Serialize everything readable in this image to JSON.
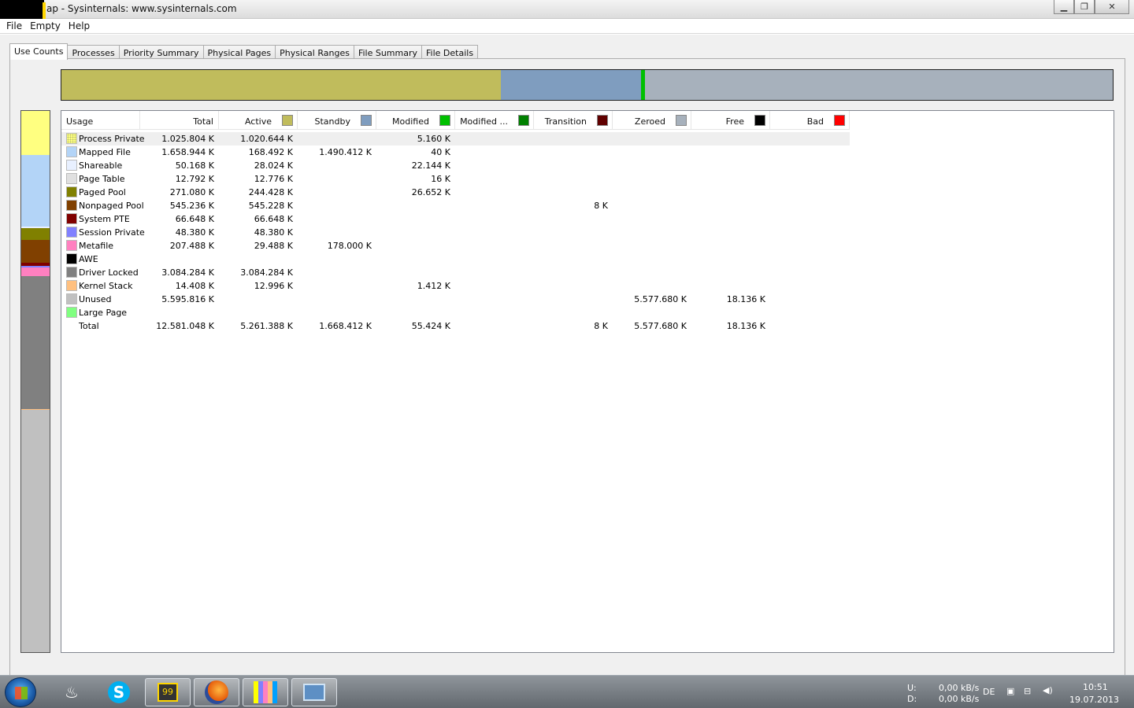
{
  "window": {
    "title": "ap - Sysinternals: www.sysinternals.com",
    "buttons": [
      "minimize",
      "maximize",
      "close"
    ]
  },
  "menu": [
    "File",
    "Empty",
    "Help"
  ],
  "tabs": [
    "Use Counts",
    "Processes",
    "Priority Summary",
    "Physical Pages",
    "Physical Ranges",
    "File Summary",
    "File Details"
  ],
  "active_tab": "Use Counts",
  "topbar_segments": [
    {
      "name": "Active",
      "fraction": 0.418,
      "color": "#c0bc5c"
    },
    {
      "name": "Standby",
      "fraction": 0.133,
      "color": "#7f9dbf"
    },
    {
      "name": "Modified",
      "fraction": 0.004,
      "color": "#00c000"
    },
    {
      "name": "Zeroed",
      "fraction": 0.445,
      "color": "#a7b1bc"
    }
  ],
  "sidebar_segments": [
    {
      "name": "Process Private",
      "fraction": 0.081,
      "color": "#ffff80"
    },
    {
      "name": "Mapped File",
      "fraction": 0.132,
      "color": "#b3d4f7"
    },
    {
      "name": "Shareable",
      "fraction": 0.004,
      "color": "#e8f0ff"
    },
    {
      "name": "Paged Pool",
      "fraction": 0.021,
      "color": "#808000"
    },
    {
      "name": "Nonpaged Pool",
      "fraction": 0.043,
      "color": "#804000"
    },
    {
      "name": "System PTE",
      "fraction": 0.005,
      "color": "#800000"
    },
    {
      "name": "Session Private",
      "fraction": 0.004,
      "color": "#8080ff"
    },
    {
      "name": "Metafile",
      "fraction": 0.016,
      "color": "#ff80c0"
    },
    {
      "name": "Driver Locked",
      "fraction": 0.245,
      "color": "#808080"
    },
    {
      "name": "Kernel Stack",
      "fraction": 0.001,
      "color": "#ffc080"
    },
    {
      "name": "Unused",
      "fraction": 0.448,
      "color": "#c0c0c0"
    }
  ],
  "columns": [
    {
      "label": "Usage",
      "swatch": null
    },
    {
      "label": "Total",
      "swatch": null
    },
    {
      "label": "Active",
      "swatch": "#c0bc5c"
    },
    {
      "label": "Standby",
      "swatch": "#7f9dbf"
    },
    {
      "label": "Modified",
      "swatch": "#00c000"
    },
    {
      "label": "Modified ...",
      "swatch": "#008000"
    },
    {
      "label": "Transition",
      "swatch": "#600000"
    },
    {
      "label": "Zeroed",
      "swatch": "#a7b1bc"
    },
    {
      "label": "Free",
      "swatch": "#000000"
    },
    {
      "label": "Bad",
      "swatch": "#ff0000"
    }
  ],
  "rows": [
    {
      "name": "Process Private",
      "color": "#ffff80",
      "values": [
        "1.025.804 K",
        "1.020.644 K",
        "",
        "5.160 K",
        "",
        "",
        "",
        "",
        ""
      ]
    },
    {
      "name": "Mapped File",
      "color": "#b3d4f7",
      "values": [
        "1.658.944 K",
        "168.492 K",
        "1.490.412 K",
        "40 K",
        "",
        "",
        "",
        "",
        ""
      ]
    },
    {
      "name": "Shareable",
      "color": "#e8f0ff",
      "values": [
        "50.168 K",
        "28.024 K",
        "",
        "22.144 K",
        "",
        "",
        "",
        "",
        ""
      ]
    },
    {
      "name": "Page Table",
      "color": "#e0e0e0",
      "values": [
        "12.792 K",
        "12.776 K",
        "",
        "16 K",
        "",
        "",
        "",
        "",
        ""
      ]
    },
    {
      "name": "Paged Pool",
      "color": "#808000",
      "values": [
        "271.080 K",
        "244.428 K",
        "",
        "26.652 K",
        "",
        "",
        "",
        "",
        ""
      ]
    },
    {
      "name": "Nonpaged Pool",
      "color": "#804000",
      "values": [
        "545.236 K",
        "545.228 K",
        "",
        "",
        "",
        "8 K",
        "",
        "",
        ""
      ]
    },
    {
      "name": "System PTE",
      "color": "#800000",
      "values": [
        "66.648 K",
        "66.648 K",
        "",
        "",
        "",
        "",
        "",
        "",
        ""
      ]
    },
    {
      "name": "Session Private",
      "color": "#8080ff",
      "values": [
        "48.380 K",
        "48.380 K",
        "",
        "",
        "",
        "",
        "",
        "",
        ""
      ]
    },
    {
      "name": "Metafile",
      "color": "#ff80c0",
      "values": [
        "207.488 K",
        "29.488 K",
        "178.000 K",
        "",
        "",
        "",
        "",
        "",
        ""
      ]
    },
    {
      "name": "AWE",
      "color": "#000000",
      "values": [
        "",
        "",
        "",
        "",
        "",
        "",
        "",
        "",
        ""
      ]
    },
    {
      "name": "Driver Locked",
      "color": "#808080",
      "values": [
        "3.084.284 K",
        "3.084.284 K",
        "",
        "",
        "",
        "",
        "",
        "",
        ""
      ]
    },
    {
      "name": "Kernel Stack",
      "color": "#ffc080",
      "values": [
        "14.408 K",
        "12.996 K",
        "",
        "1.412 K",
        "",
        "",
        "",
        "",
        ""
      ]
    },
    {
      "name": "Unused",
      "color": "#c0c0c0",
      "values": [
        "5.595.816 K",
        "",
        "",
        "",
        "",
        "",
        "5.577.680 K",
        "18.136 K",
        ""
      ]
    },
    {
      "name": "Large Page",
      "color": "#80ff80",
      "values": [
        "",
        "",
        "",
        "",
        "",
        "",
        "",
        "",
        ""
      ]
    },
    {
      "name": "Total",
      "color": null,
      "values": [
        "12.581.048 K",
        "5.261.388 K",
        "1.668.412 K",
        "55.424 K",
        "",
        "8 K",
        "5.577.680 K",
        "18.136 K",
        ""
      ]
    }
  ],
  "taskbar": {
    "apps": [
      "steam-icon",
      "skype-icon",
      "network-meter-icon",
      "firefox-icon",
      "rammap-icon",
      "remote-desktop-icon"
    ],
    "net_up_label": "U:",
    "net_down_label": "D:",
    "net_up": "0,00 kB/s",
    "net_down": "0,00 kB/s",
    "language": "DE",
    "time": "10:51",
    "date": "19.07.2013"
  }
}
